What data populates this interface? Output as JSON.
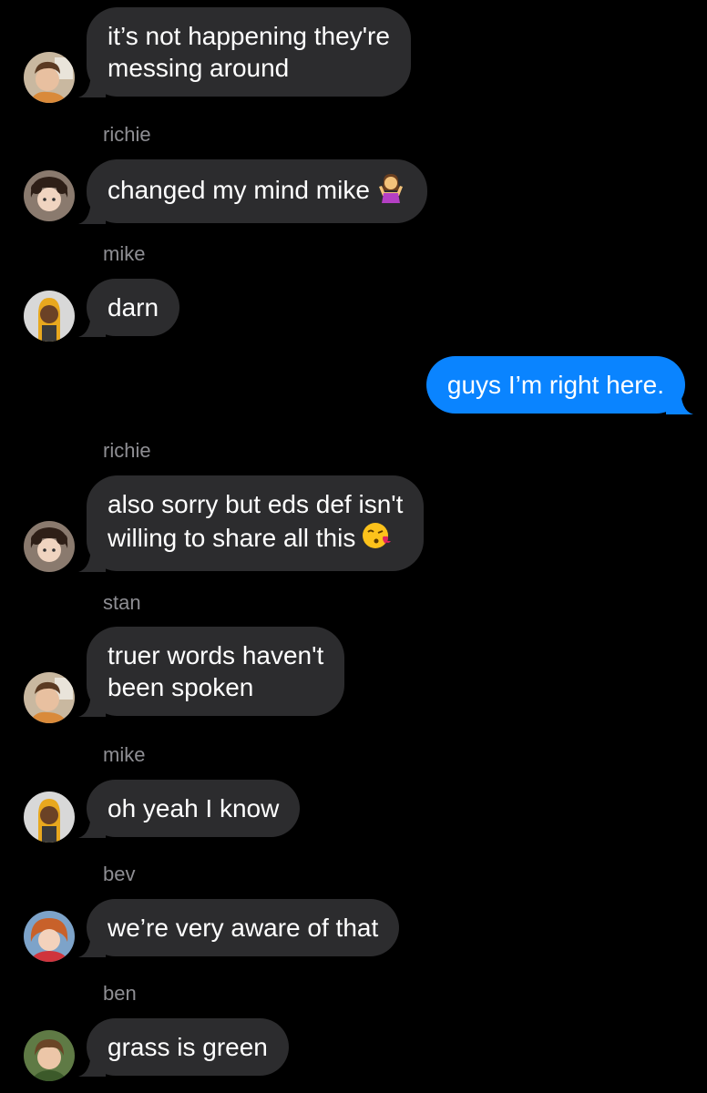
{
  "messages": [
    {
      "sender": "",
      "text_lines": [
        "it’s not happening they're",
        "messing around"
      ],
      "direction": "in",
      "avatar_icon": "stan-avatar"
    },
    {
      "sender": "richie",
      "text_lines": [
        "changed my mind mike"
      ],
      "emoji": "woman-shrugging",
      "direction": "in",
      "avatar_icon": "richie-avatar"
    },
    {
      "sender": "mike",
      "text_lines": [
        "darn"
      ],
      "direction": "in",
      "avatar_icon": "mike-avatar"
    },
    {
      "sender": "",
      "text_lines": [
        "guys I’m right here."
      ],
      "direction": "out"
    },
    {
      "sender": "richie",
      "text_lines": [
        "also sorry but eds def isn't",
        "willing to share all this"
      ],
      "emoji": "face-blowing-kiss",
      "direction": "in",
      "avatar_icon": "richie-avatar"
    },
    {
      "sender": "stan",
      "text_lines": [
        "truer words haven't",
        "been spoken"
      ],
      "direction": "in",
      "avatar_icon": "stan-avatar"
    },
    {
      "sender": "mike",
      "text_lines": [
        "oh yeah I know"
      ],
      "direction": "in",
      "avatar_icon": "mike-avatar"
    },
    {
      "sender": "bev",
      "text_lines": [
        "we’re very aware of that"
      ],
      "direction": "in",
      "avatar_icon": "bev-avatar"
    },
    {
      "sender": "ben",
      "text_lines": [
        "grass is green"
      ],
      "direction": "in",
      "avatar_icon": "ben-avatar"
    }
  ],
  "colors": {
    "background": "#000000",
    "incoming_bubble": "#2c2c2e",
    "outgoing_bubble": "#0a84ff",
    "sender_label": "#8e8e93",
    "text": "#ffffff"
  }
}
